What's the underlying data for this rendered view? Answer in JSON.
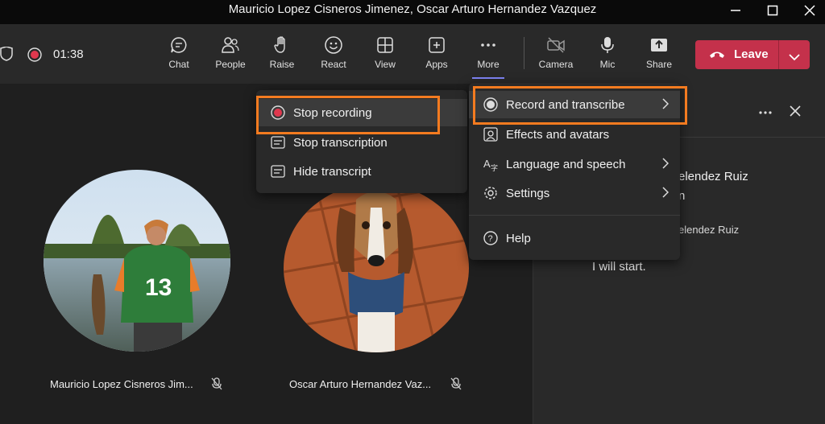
{
  "window": {
    "title": "Mauricio Lopez Cisneros Jimenez, Oscar Arturo Hernandez Vazquez"
  },
  "meeting": {
    "timer": "01:38"
  },
  "toolbar": {
    "chat": "Chat",
    "people": "People",
    "raise": "Raise",
    "react": "React",
    "view": "View",
    "apps": "Apps",
    "more": "More",
    "camera": "Camera",
    "mic": "Mic",
    "share": "Share",
    "leave": "Leave"
  },
  "more_menu": {
    "items": [
      {
        "label": "Record and transcribe",
        "icon": "record-icon"
      },
      {
        "label": "Effects and avatars",
        "icon": "effects-icon"
      },
      {
        "label": "Language and speech",
        "icon": "language-icon"
      },
      {
        "label": "Settings",
        "icon": "gear-icon"
      },
      {
        "label": "Help",
        "icon": "help-icon"
      }
    ]
  },
  "record_submenu": {
    "items": [
      {
        "label": "Stop recording",
        "icon": "stop-record-icon"
      },
      {
        "label": "Stop transcription",
        "icon": "transcript-icon"
      },
      {
        "label": "Hide transcript",
        "icon": "transcript-icon"
      }
    ]
  },
  "participants": [
    {
      "name": "Mauricio Lopez Cisneros Jim..."
    },
    {
      "name": "Oscar Arturo Hernandez Vaz..."
    }
  ],
  "transcript": {
    "lines": [
      "elendez Ruiz",
      "n",
      "elendez Ruiz",
      "I will start."
    ]
  },
  "colors": {
    "accent": "#f47b20",
    "leave": "#c4314b",
    "record": "#e0384e"
  }
}
